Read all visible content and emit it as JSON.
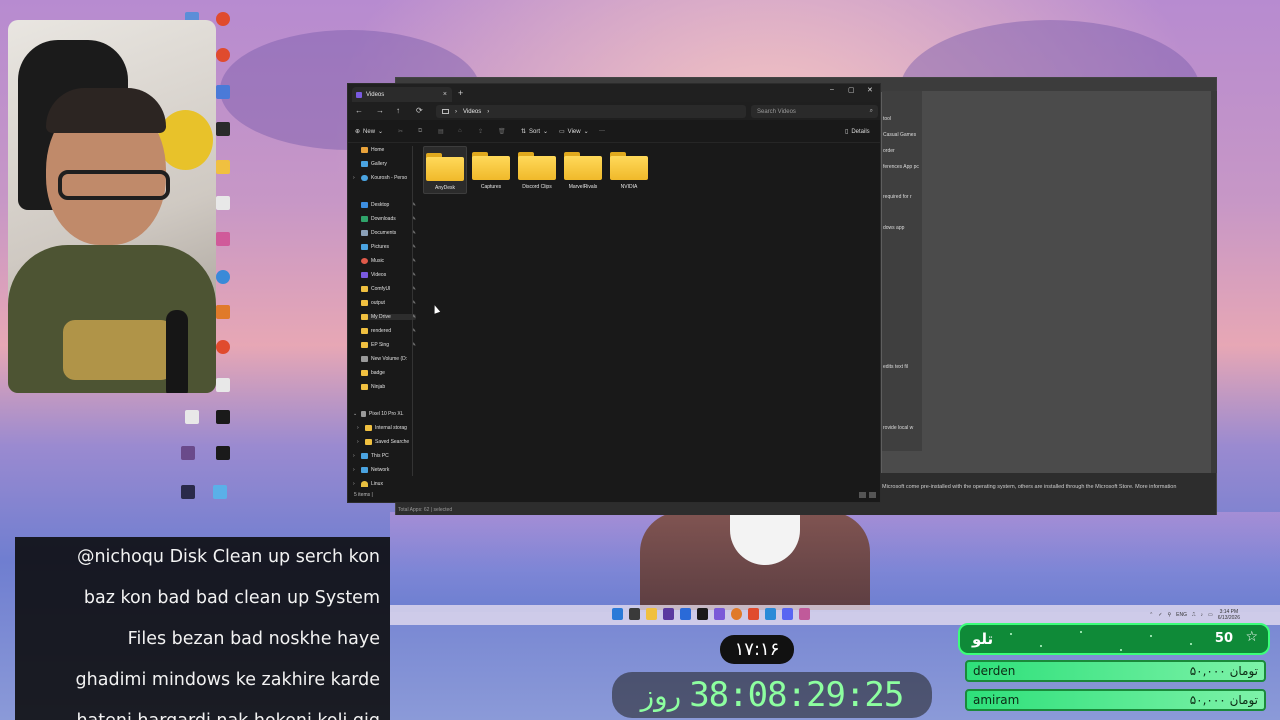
{
  "explorer": {
    "tab_title": "Videos",
    "tab_close": "×",
    "new_tab": "+",
    "window_controls": [
      "–",
      "▢",
      "✕"
    ],
    "nav": {
      "back": "←",
      "forward": "→",
      "up": "↑",
      "refresh": "⟳"
    },
    "breadcrumb": [
      "Videos"
    ],
    "search_placeholder": "Search Videos",
    "commands": {
      "new": "New",
      "sort": "Sort",
      "view": "View",
      "more": "···",
      "details": "Details"
    },
    "sidebar": {
      "top": [
        {
          "label": "Home",
          "icon": "home-icon",
          "color": "#e8a23a"
        },
        {
          "label": "Gallery",
          "icon": "gallery-icon",
          "color": "#4aa3e0"
        },
        {
          "label": "Kourosh - Perso",
          "icon": "onedrive-icon",
          "color": "#4aa3e0"
        }
      ],
      "pinned": [
        {
          "label": "Desktop",
          "icon": "desktop-icon",
          "color": "#3d8ee0"
        },
        {
          "label": "Downloads",
          "icon": "download-icon",
          "color": "#2fa36a"
        },
        {
          "label": "Documents",
          "icon": "documents-icon",
          "color": "#8aa0b8"
        },
        {
          "label": "Pictures",
          "icon": "pictures-icon",
          "color": "#4aa3e0"
        },
        {
          "label": "Music",
          "icon": "music-icon",
          "color": "#e05a4a"
        },
        {
          "label": "Videos",
          "icon": "videos-icon",
          "color": "#7a5ae0"
        },
        {
          "label": "ComfyUI",
          "icon": "folder-icon",
          "color": "#f0c040"
        },
        {
          "label": "output",
          "icon": "folder-icon",
          "color": "#f0c040"
        },
        {
          "label": "My Drive",
          "icon": "drive-icon",
          "color": "#f0c040"
        },
        {
          "label": "rendered",
          "icon": "folder-icon",
          "color": "#f0c040"
        },
        {
          "label": "EP Sing",
          "icon": "folder-icon",
          "color": "#f0c040"
        },
        {
          "label": "New Volume (D:",
          "icon": "drive-icon",
          "color": "#9a9a9a"
        },
        {
          "label": "badge",
          "icon": "folder-icon",
          "color": "#f0c040"
        },
        {
          "label": "Ninjab",
          "icon": "folder-icon",
          "color": "#f0c040"
        }
      ],
      "devices": [
        {
          "label": "Pixel 10 Pro XL",
          "icon": "phone-icon",
          "color": "#9a9a9a"
        },
        {
          "label": "Internal storag",
          "icon": "folder-icon",
          "color": "#f0c040"
        },
        {
          "label": "Saved Searche",
          "icon": "folder-icon",
          "color": "#f0c040"
        },
        {
          "label": "This PC",
          "icon": "pc-icon",
          "color": "#4aa3e0"
        },
        {
          "label": "Network",
          "icon": "network-icon",
          "color": "#4aa3e0"
        },
        {
          "label": "Linux",
          "icon": "linux-icon",
          "color": "#e8c040"
        }
      ]
    },
    "folders": [
      "AnyDesk",
      "Captures",
      "Discord Clips",
      "MarvelRivals",
      "NVIDIA"
    ],
    "status": "5 items  |"
  },
  "background_window": {
    "rows": [
      {
        "text": "tool"
      },
      {
        "text": "Casual Games"
      },
      {
        "text": "order"
      },
      {
        "text": "ferences App pc"
      },
      {
        "text": "required for r"
      },
      {
        "text": "dows app"
      },
      {
        "text": "edits text fil"
      },
      {
        "text": "rovide local w"
      }
    ],
    "description": "Microsoft  come pre-installed with the operating system, others are installed through the Microsoft Store. More information",
    "status": "Total Apps: 62   |  selected"
  },
  "taskbar": {
    "tray_lang": "ENG",
    "time": "3:14 PM",
    "date": "6/13/2026"
  },
  "chat": {
    "lines": [
      "@nichoqu Disk Clean up serch kon",
      "baz kon bad bad clean up System",
      "Files bezan bad noskhe haye",
      "ghadimi mindows ke zakhire karde",
      "hateni hargardi nak hokoni koli gig"
    ]
  },
  "clock": "۱۷:۱۶",
  "timer": {
    "digits": "38:08:29:25",
    "unit": "روز"
  },
  "donations": {
    "title": "تلو",
    "count": "50",
    "star": "☆",
    "rows": [
      {
        "name": "derden",
        "amount": "۵۰,۰۰۰ تومان"
      },
      {
        "name": "amiram",
        "amount": "۵۰,۰۰۰ تومان"
      }
    ]
  }
}
